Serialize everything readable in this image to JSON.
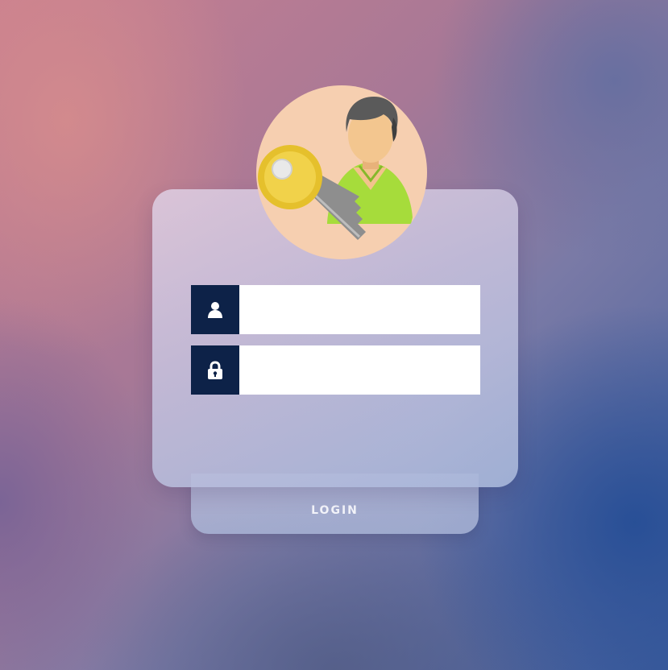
{
  "form": {
    "username": {
      "value": "",
      "placeholder": "",
      "icon": "user-icon"
    },
    "password": {
      "value": "",
      "placeholder": "",
      "icon": "lock-icon"
    },
    "login_label": "LOGIN"
  },
  "avatar": {
    "icon": "user-key-icon"
  },
  "colors": {
    "icon_box": "#0d2248",
    "avatar_bg": "#f6cfb0",
    "input_bg": "#ffffff",
    "login_text": "#f3f4fa"
  }
}
